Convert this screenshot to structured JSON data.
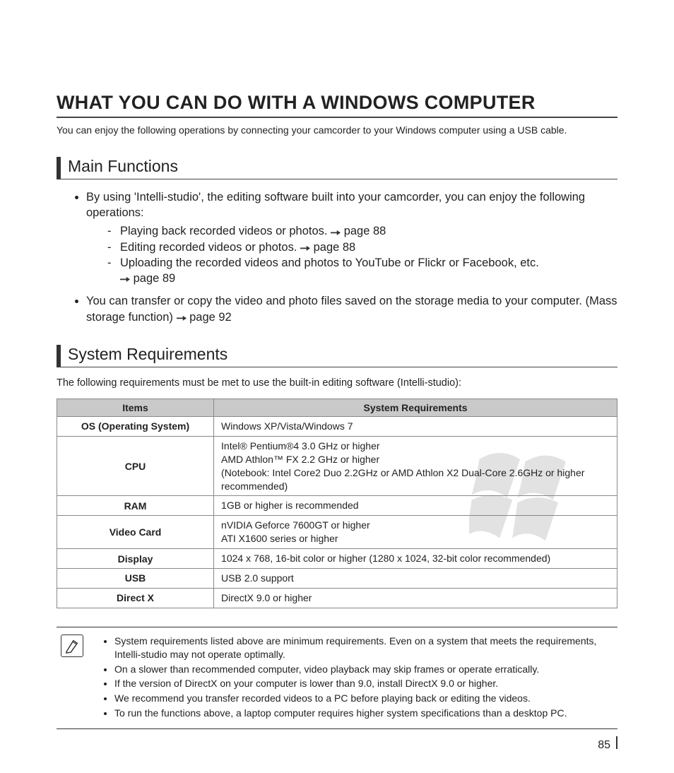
{
  "page": {
    "title": "WHAT YOU CAN DO WITH A WINDOWS COMPUTER",
    "intro": "You can enjoy the following operations by connecting your camcorder to your Windows computer using a USB cable.",
    "page_number": "85"
  },
  "main_functions": {
    "heading": "Main Functions",
    "b1": "By using 'Intelli-studio', the editing software built into your camcorder, you can enjoy the following operations:",
    "d1a": "Playing back recorded videos or photos. ",
    "d1b": "page 88",
    "d2a": "Editing recorded videos or photos. ",
    "d2b": "page 88",
    "d3a": "Uploading the recorded videos and photos to YouTube or Flickr or Facebook, etc.",
    "d3b": "page 89",
    "b2a": "You can transfer or copy the video and photo files saved on the storage media to your computer. (Mass storage function) ",
    "b2b": "page 92"
  },
  "sysreq": {
    "heading": "System Requirements",
    "intro": "The following requirements must be met to use the built-in editing software (Intelli-studio):",
    "col1": "Items",
    "col2": "System Requirements",
    "rows": {
      "os_label": "OS (Operating System)",
      "os_val": "Windows XP/Vista/Windows 7",
      "cpu_label": "CPU",
      "cpu_l1": "Intel® Pentium®4 3.0 GHz or higher",
      "cpu_l2": "AMD Athlon™ FX 2.2 GHz or higher",
      "cpu_l3": "(Notebook: Intel Core2 Duo 2.2GHz or AMD Athlon X2 Dual-Core 2.6GHz or higher recommended)",
      "ram_label": "RAM",
      "ram_val": "1GB or higher is recommended",
      "vc_label": "Video Card",
      "vc_l1": "nVIDIA Geforce 7600GT or higher",
      "vc_l2": "ATI X1600 series or higher",
      "disp_label": "Display",
      "disp_val": "1024 x 768, 16-bit color or higher (1280 x 1024, 32-bit color recommended)",
      "usb_label": "USB",
      "usb_val": "USB 2.0 support",
      "dx_label": "Direct X",
      "dx_val": "DirectX 9.0 or higher"
    }
  },
  "notes": {
    "n1": "System requirements listed above are minimum requirements. Even on a system that meets the requirements, Intelli-studio may not operate optimally.",
    "n2": "On a slower than recommended computer, video playback may skip frames or operate erratically.",
    "n3": "If the version of DirectX on your computer is lower than 9.0, install DirectX 9.0 or higher.",
    "n4": "We recommend you transfer recorded videos to a PC before playing back or editing the videos.",
    "n5": "To run the functions above, a laptop computer requires higher system specifications than a desktop PC."
  }
}
